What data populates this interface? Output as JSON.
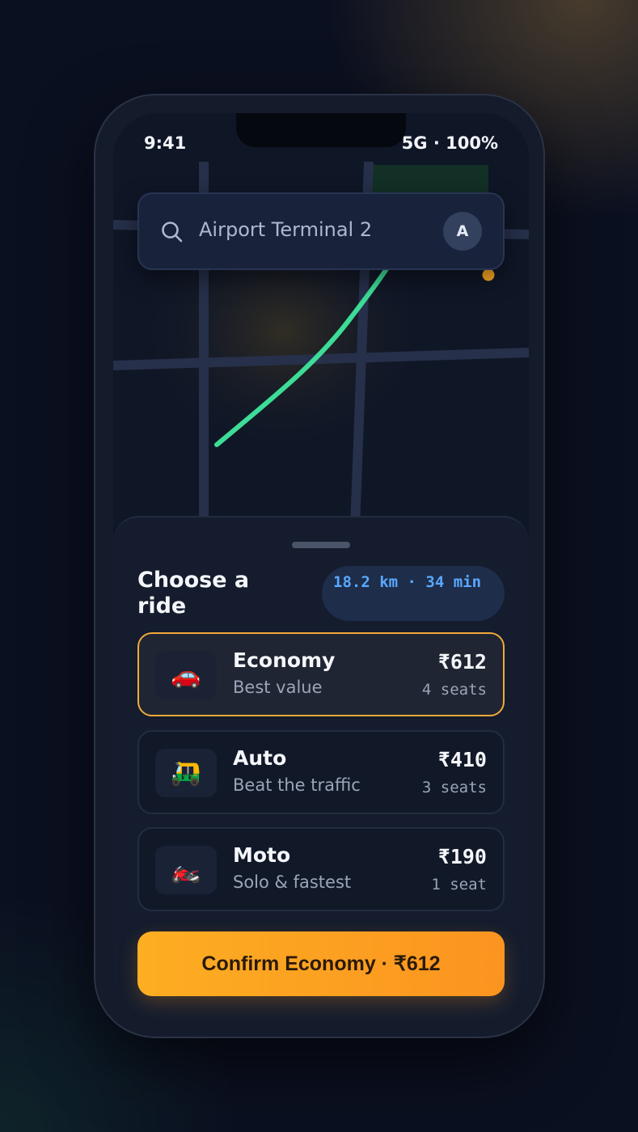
{
  "status": {
    "time": "9:41",
    "network": "5G · 100%"
  },
  "search": {
    "query": "Airport Terminal 2",
    "avatar_initial": "A"
  },
  "sheet": {
    "title": "Choose a ride",
    "trip_info": "18.2 km · 34 min"
  },
  "rides": [
    {
      "name": "Economy",
      "subtitle": "Best value",
      "price": "₹612",
      "seats": "4 seats",
      "icon": "car-icon",
      "glyph": "🚗",
      "selected": true
    },
    {
      "name": "Auto",
      "subtitle": "Beat the traffic",
      "price": "₹410",
      "seats": "3 seats",
      "icon": "auto-rickshaw-icon",
      "glyph": "🛺",
      "selected": false
    },
    {
      "name": "Moto",
      "subtitle": "Solo & fastest",
      "price": "₹190",
      "seats": "1 seat",
      "icon": "motorcycle-icon",
      "glyph": "🏍️",
      "selected": false
    }
  ],
  "confirm_label": "Confirm Economy · ₹612",
  "colors": {
    "accent": "#f2a93b",
    "route": "#3ddc97",
    "destination": "#f5a623",
    "chip_text": "#5aa8ff"
  }
}
